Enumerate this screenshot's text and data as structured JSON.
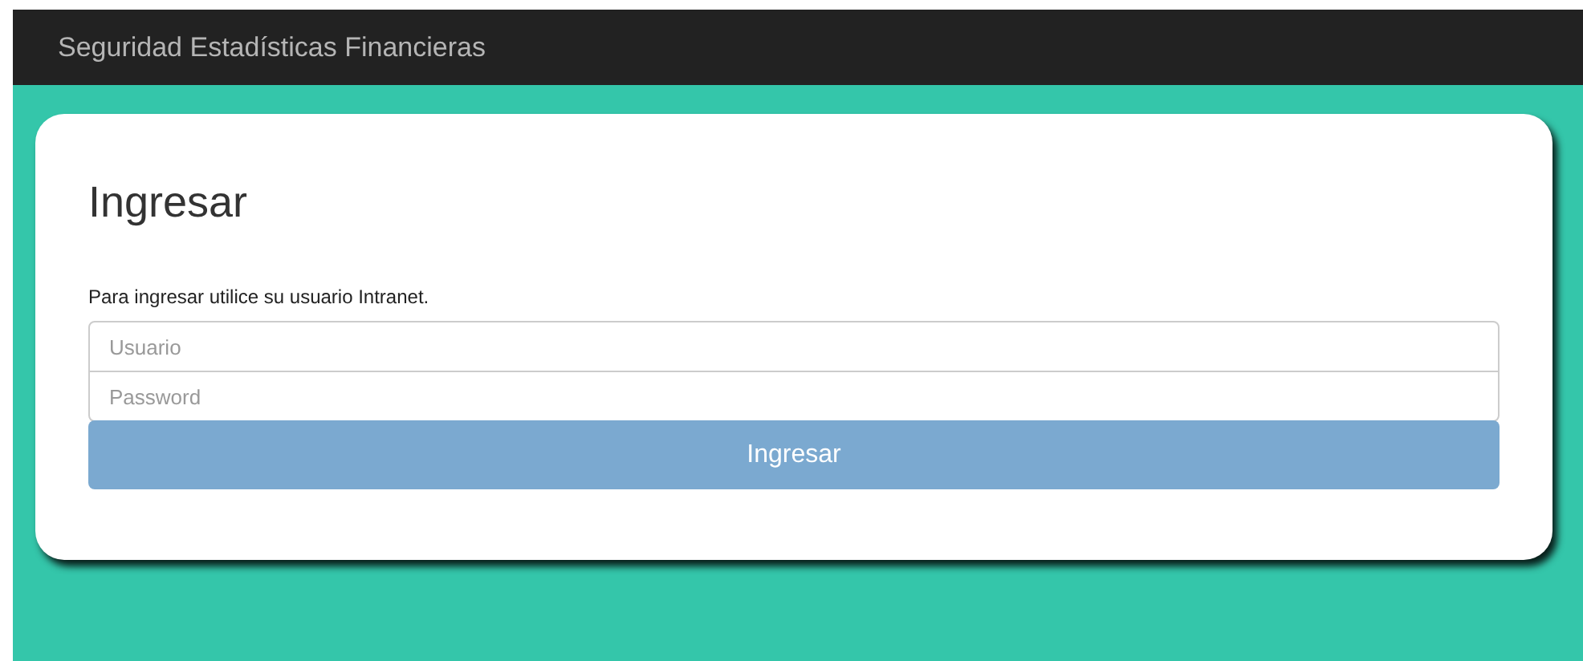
{
  "navbar": {
    "title": "Seguridad Estadísticas Financieras"
  },
  "login": {
    "heading": "Ingresar",
    "instructions": "Para ingresar utilice su usuario Intranet.",
    "username": {
      "placeholder": "Usuario"
    },
    "password": {
      "placeholder": "Password"
    },
    "submit": "Ingresar"
  }
}
